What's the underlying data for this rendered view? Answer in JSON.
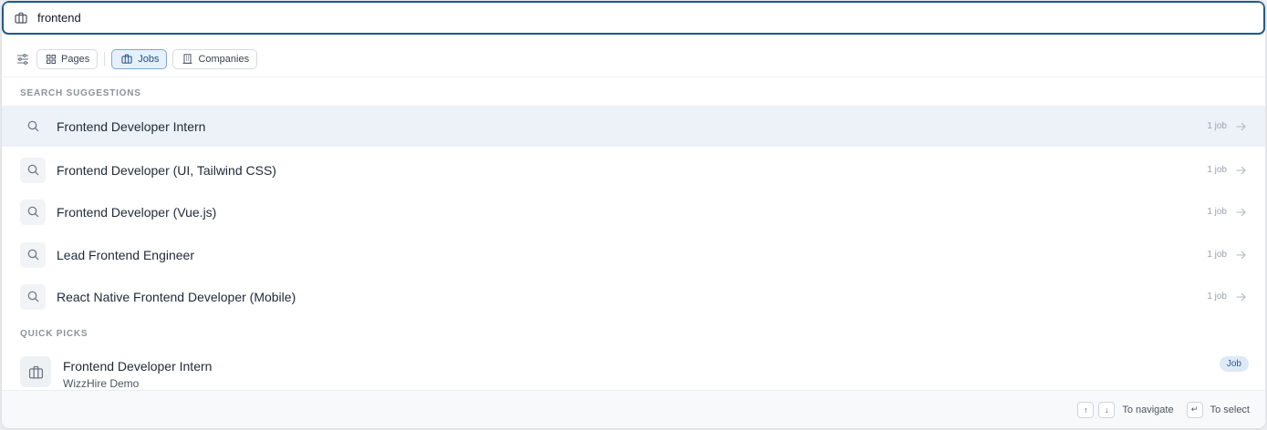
{
  "search": {
    "value": "frontend",
    "icon": "briefcase-icon"
  },
  "filters": {
    "icon": "sliders-icon",
    "chips": [
      {
        "label": "Pages",
        "icon": "grid-icon",
        "active": false
      },
      {
        "label": "Jobs",
        "icon": "briefcase-icon",
        "active": true
      },
      {
        "label": "Companies",
        "icon": "building-icon",
        "active": false
      }
    ]
  },
  "suggestions": {
    "heading": "SEARCH SUGGESTIONS",
    "items": [
      {
        "label": "Frontend Developer Intern",
        "count": "1 job"
      },
      {
        "label": "Frontend Developer (UI, Tailwind CSS)",
        "count": "1 job"
      },
      {
        "label": "Frontend Developer (Vue.js)",
        "count": "1 job"
      },
      {
        "label": "Lead Frontend Engineer",
        "count": "1 job"
      },
      {
        "label": "React Native Frontend Developer (Mobile)",
        "count": "1 job"
      }
    ]
  },
  "quick_picks": {
    "heading": "QUICK PICKS",
    "items": [
      {
        "title": "Frontend Developer Intern",
        "subtitle": "WizzHire Demo",
        "badge": "Job"
      }
    ]
  },
  "footer": {
    "up_key": "↑",
    "down_key": "↓",
    "navigate_label": "To navigate",
    "enter_key": "↵",
    "select_label": "To select"
  },
  "colors": {
    "accent_border": "#1f5a8c",
    "highlight_row": "#edf2f8",
    "badge_bg": "#dde9f7"
  }
}
